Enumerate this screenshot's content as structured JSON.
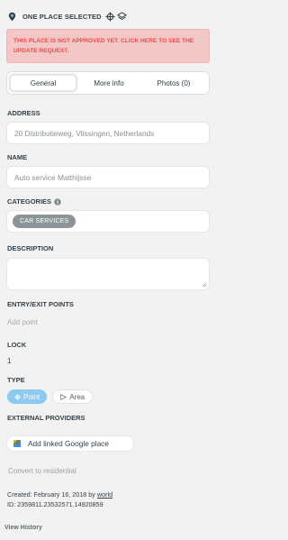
{
  "header": {
    "title": "ONE PLACE SELECTED"
  },
  "alert": {
    "text": "THIS PLACE IS NOT APPROVED YET. CLICK HERE TO SEE THE UPDATE REQUEST."
  },
  "tabs": [
    {
      "label": "General",
      "active": true
    },
    {
      "label": "More info",
      "active": false
    },
    {
      "label": "Photos (0)",
      "active": false
    }
  ],
  "address": {
    "label": "ADDRESS",
    "value": "20 Distributieweg, Vlissingen, Netherlands"
  },
  "name": {
    "label": "NAME",
    "value": "Auto service Matthijsse"
  },
  "categories": {
    "label": "CATEGORIES",
    "items": [
      "CAR SERVICES"
    ]
  },
  "description": {
    "label": "DESCRIPTION",
    "value": ""
  },
  "entry_exit": {
    "label": "ENTRY/EXIT POINTS",
    "add_label": "Add point"
  },
  "lock": {
    "label": "LOCK",
    "value": "1"
  },
  "type": {
    "label": "TYPE",
    "options": [
      {
        "label": "Point",
        "active": true
      },
      {
        "label": "Area",
        "active": false
      }
    ]
  },
  "external": {
    "label": "EXTERNAL PROVIDERS",
    "button_label": "Add linked Google place"
  },
  "convert_label": "Convert to residential",
  "meta": {
    "created_prefix": "Created: February 16, 2018 by",
    "created_user": "world",
    "id_line": "ID: 2359811.23532571.14920859"
  },
  "view_history_label": "View History",
  "colors": {
    "alert_bg": "#f4c7c7",
    "alert_text": "#e84c4c",
    "chip": "#8c9497",
    "active_type": "#8dcaef"
  }
}
